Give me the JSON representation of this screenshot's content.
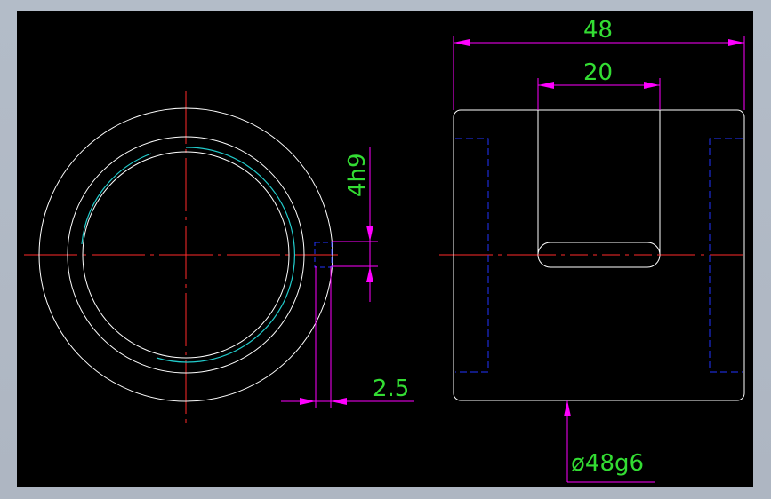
{
  "colors": {
    "background": "#000000",
    "outline": "#ffffff",
    "centerline": "#ff2a2a",
    "dimension_line": "#ff00ff",
    "dimension_text": "#33dd33",
    "hidden_line": "#2233ff",
    "thread_line": "#22cccc"
  },
  "dimensions": {
    "overall_length": "48",
    "groove_length": "20",
    "groove_width": "4h9",
    "groove_depth": "2.5",
    "outer_diameter": "ø48g6"
  }
}
